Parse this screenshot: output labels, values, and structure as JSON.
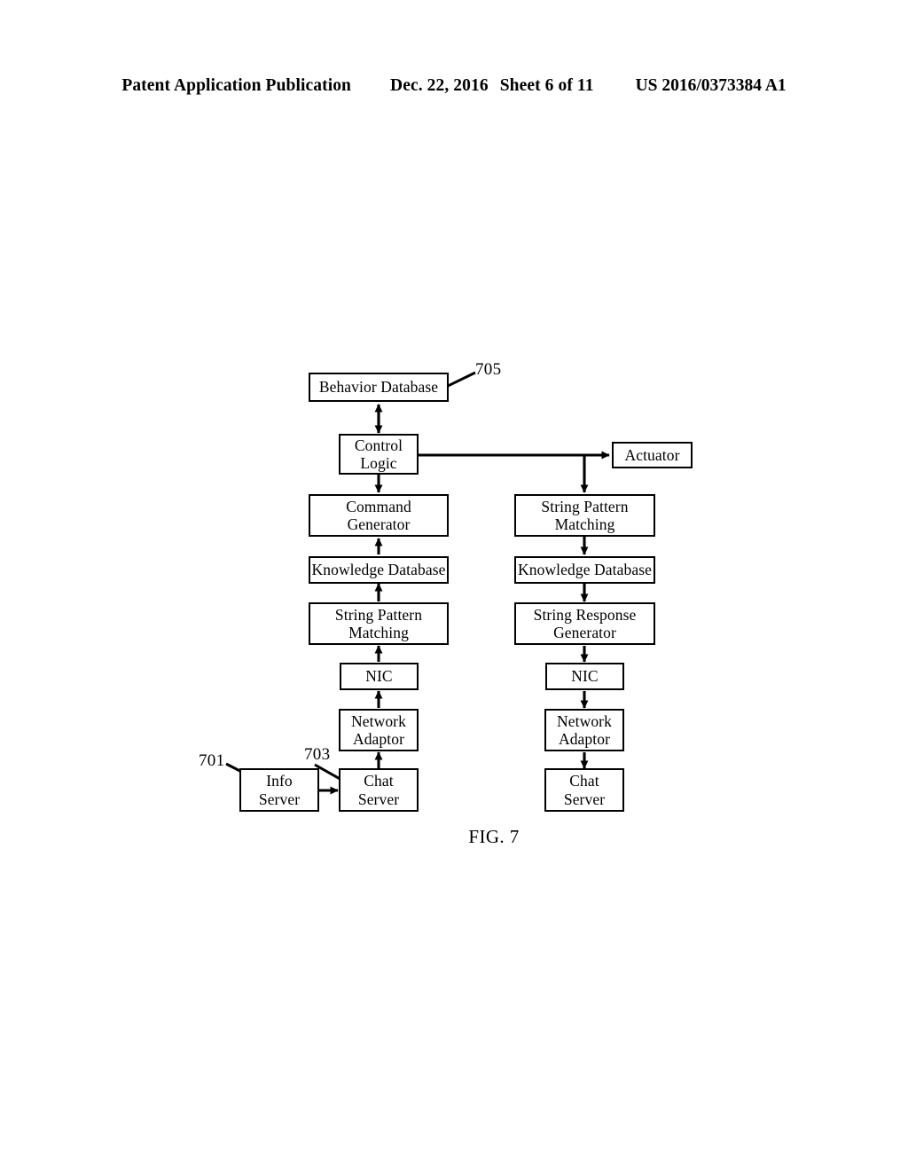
{
  "header": {
    "publication": "Patent Application Publication",
    "date": "Dec. 22, 2016",
    "sheet": "Sheet 6 of 11",
    "patent_number": "US 2016/0373384 A1"
  },
  "figure": {
    "caption": "FIG. 7",
    "reference_numerals": [
      {
        "id": "701",
        "label": "701",
        "points_to": "Info Server"
      },
      {
        "id": "703",
        "label": "703",
        "points_to": "Chat Server"
      },
      {
        "id": "705",
        "label": "705",
        "points_to": "Behavior Database"
      }
    ],
    "nodes": [
      {
        "id": "behavior-database",
        "line1": "Behavior Database",
        "line2": ""
      },
      {
        "id": "control-logic",
        "line1": "Control",
        "line2": "Logic"
      },
      {
        "id": "actuator",
        "line1": "Actuator",
        "line2": ""
      },
      {
        "id": "command-generator",
        "line1": "Command",
        "line2": "Generator"
      },
      {
        "id": "knowledge-database-left",
        "line1": "Knowledge Database",
        "line2": ""
      },
      {
        "id": "string-pattern-matching-left",
        "line1": "String Pattern",
        "line2": "Matching"
      },
      {
        "id": "nic-left",
        "line1": "NIC",
        "line2": ""
      },
      {
        "id": "network-adaptor-left",
        "line1": "Network",
        "line2": "Adaptor"
      },
      {
        "id": "info-server",
        "line1": "Info",
        "line2": "Server"
      },
      {
        "id": "chat-server-left",
        "line1": "Chat",
        "line2": "Server"
      },
      {
        "id": "string-pattern-matching-right",
        "line1": "String Pattern",
        "line2": "Matching"
      },
      {
        "id": "knowledge-database-right",
        "line1": "Knowledge Database",
        "line2": ""
      },
      {
        "id": "string-response-generator",
        "line1": "String Response",
        "line2": "Generator"
      },
      {
        "id": "nic-right",
        "line1": "NIC",
        "line2": ""
      },
      {
        "id": "network-adaptor-right",
        "line1": "Network",
        "line2": "Adaptor"
      },
      {
        "id": "chat-server-right",
        "line1": "Chat",
        "line2": "Server"
      }
    ],
    "connections": [
      {
        "from": "control-logic",
        "to": "behavior-database",
        "style": "bidirectional"
      },
      {
        "from": "control-logic",
        "to": "actuator",
        "style": "arrow"
      },
      {
        "from": "control-logic",
        "to": "string-pattern-matching-right",
        "style": "arrow"
      },
      {
        "from": "control-logic",
        "to": "command-generator",
        "style": "arrow"
      },
      {
        "from": "knowledge-database-left",
        "to": "command-generator",
        "style": "arrow"
      },
      {
        "from": "string-pattern-matching-left",
        "to": "knowledge-database-left",
        "style": "arrow"
      },
      {
        "from": "nic-left",
        "to": "string-pattern-matching-left",
        "style": "arrow"
      },
      {
        "from": "network-adaptor-left",
        "to": "nic-left",
        "style": "arrow"
      },
      {
        "from": "chat-server-left",
        "to": "network-adaptor-left",
        "style": "arrow"
      },
      {
        "from": "info-server",
        "to": "chat-server-left",
        "style": "arrow"
      },
      {
        "from": "string-pattern-matching-right",
        "to": "knowledge-database-right",
        "style": "arrow"
      },
      {
        "from": "knowledge-database-right",
        "to": "string-response-generator",
        "style": "arrow"
      },
      {
        "from": "string-response-generator",
        "to": "nic-right",
        "style": "arrow"
      },
      {
        "from": "nic-right",
        "to": "network-adaptor-right",
        "style": "arrow"
      },
      {
        "from": "network-adaptor-right",
        "to": "chat-server-right",
        "style": "arrow"
      }
    ]
  }
}
